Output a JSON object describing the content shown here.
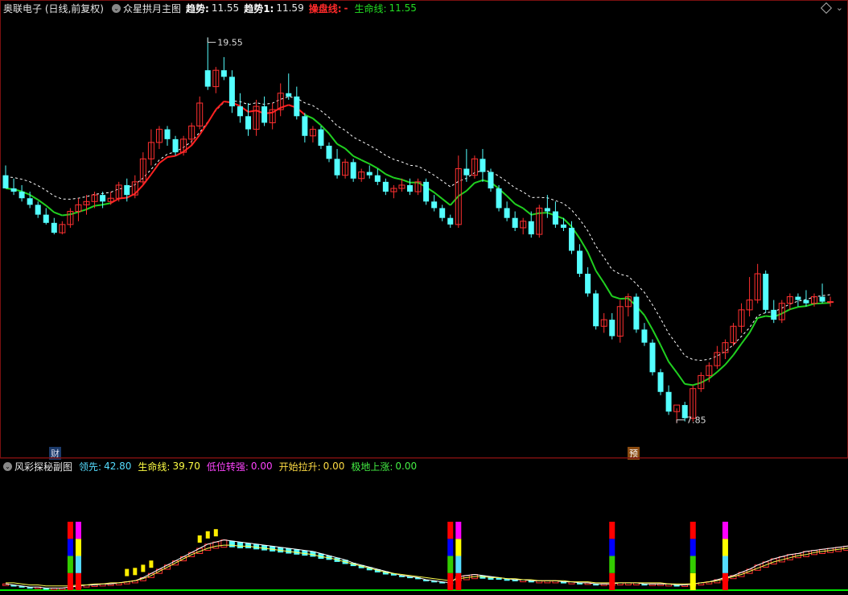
{
  "main_header": {
    "stock": "奥联电子 (日线,前复权)",
    "indicator": "众星拱月主图",
    "trend_label": "趋势:",
    "trend_value": "11.55",
    "trend1_label": "趋势1:",
    "trend1_value": "11.59",
    "operate_label": "操盘线:",
    "operate_value": "-",
    "life_label": "生命线:",
    "life_value": "11.55"
  },
  "sub_header": {
    "indicator": "风彩探秘副图",
    "lead_label": "领先:",
    "lead_value": "42.80",
    "life_label": "生命线:",
    "life_value": "39.70",
    "low_label": "低位转强:",
    "low_value": "0.00",
    "start_label": "开始拉升:",
    "start_value": "0.00",
    "bottom_label": "极地上涨:",
    "bottom_value": "0.00"
  },
  "markers": {
    "cai": "财",
    "yu": "预"
  },
  "colors": {
    "up": "#ff3030",
    "down": "#54ffff",
    "life_up": "#ff2020",
    "life_down": "#20d020",
    "lead_line": "#ffffff",
    "life_line": "#ffff50",
    "base_line": "#00ee00"
  },
  "chart_data": {
    "type": "candlestick",
    "price_range": [
      7.2,
      20.2
    ],
    "max_label": "19.55",
    "min_label": "7.85",
    "candles": [
      [
        15.4,
        15.7,
        15.0,
        15.0
      ],
      [
        15.0,
        15.3,
        14.8,
        14.9
      ],
      [
        14.9,
        15.1,
        14.6,
        14.7
      ],
      [
        14.7,
        14.9,
        14.4,
        14.5
      ],
      [
        14.5,
        14.6,
        14.1,
        14.2
      ],
      [
        14.2,
        14.4,
        13.9,
        13.95
      ],
      [
        13.95,
        14.1,
        13.6,
        13.65
      ],
      [
        13.65,
        14.0,
        13.6,
        13.9
      ],
      [
        13.9,
        14.4,
        13.8,
        14.3
      ],
      [
        14.3,
        14.7,
        14.0,
        14.5
      ],
      [
        14.5,
        14.8,
        14.2,
        14.6
      ],
      [
        14.6,
        14.9,
        14.4,
        14.8
      ],
      [
        14.8,
        14.9,
        14.4,
        14.6
      ],
      [
        14.6,
        14.9,
        14.5,
        14.7
      ],
      [
        14.7,
        15.2,
        14.6,
        15.1
      ],
      [
        15.1,
        15.3,
        14.6,
        14.8
      ],
      [
        14.8,
        15.4,
        14.7,
        15.2
      ],
      [
        15.2,
        16.1,
        15.1,
        15.9
      ],
      [
        15.9,
        16.8,
        15.7,
        16.4
      ],
      [
        16.4,
        16.9,
        16.2,
        16.8
      ],
      [
        16.8,
        16.9,
        16.3,
        16.5
      ],
      [
        16.5,
        16.6,
        16.0,
        16.1
      ],
      [
        16.1,
        16.6,
        16.0,
        16.5
      ],
      [
        16.5,
        17.0,
        16.3,
        16.9
      ],
      [
        16.9,
        17.8,
        16.8,
        17.6
      ],
      [
        18.6,
        19.6,
        18.0,
        18.1
      ],
      [
        18.1,
        18.7,
        17.9,
        18.6
      ],
      [
        18.6,
        19.0,
        18.3,
        18.4
      ],
      [
        18.4,
        18.6,
        17.3,
        17.5
      ],
      [
        17.5,
        17.9,
        17.0,
        17.2
      ],
      [
        17.2,
        17.6,
        16.6,
        16.8
      ],
      [
        16.8,
        17.7,
        16.6,
        17.5
      ],
      [
        17.5,
        17.8,
        16.9,
        17.0
      ],
      [
        17.0,
        17.6,
        16.8,
        17.4
      ],
      [
        17.4,
        18.2,
        17.2,
        17.9
      ],
      [
        17.9,
        18.5,
        17.7,
        17.8
      ],
      [
        17.8,
        18.1,
        17.1,
        17.2
      ],
      [
        17.2,
        17.3,
        16.4,
        16.6
      ],
      [
        16.6,
        16.9,
        16.4,
        16.8
      ],
      [
        16.8,
        16.9,
        16.2,
        16.3
      ],
      [
        16.3,
        16.4,
        15.8,
        15.9
      ],
      [
        15.9,
        16.2,
        15.3,
        15.4
      ],
      [
        15.4,
        15.9,
        15.3,
        15.8
      ],
      [
        15.8,
        15.9,
        15.2,
        15.3
      ],
      [
        15.3,
        15.6,
        15.2,
        15.5
      ],
      [
        15.5,
        15.7,
        15.3,
        15.4
      ],
      [
        15.4,
        15.6,
        15.1,
        15.2
      ],
      [
        15.2,
        15.3,
        14.8,
        14.9
      ],
      [
        14.9,
        15.1,
        14.7,
        15.0
      ],
      [
        15.0,
        15.3,
        14.9,
        15.1
      ],
      [
        15.1,
        15.3,
        14.8,
        14.9
      ],
      [
        14.9,
        15.3,
        14.8,
        15.2
      ],
      [
        15.2,
        15.3,
        14.5,
        14.6
      ],
      [
        14.6,
        14.8,
        14.3,
        14.4
      ],
      [
        14.4,
        14.5,
        14.0,
        14.1
      ],
      [
        14.1,
        14.2,
        13.8,
        13.9
      ],
      [
        13.9,
        16.0,
        13.8,
        15.6
      ],
      [
        15.6,
        16.2,
        15.2,
        15.4
      ],
      [
        15.4,
        16.0,
        15.3,
        15.9
      ],
      [
        15.9,
        16.2,
        15.2,
        15.5
      ],
      [
        15.5,
        15.6,
        14.9,
        15.0
      ],
      [
        15.0,
        15.1,
        14.3,
        14.4
      ],
      [
        14.4,
        14.6,
        14.0,
        14.1
      ],
      [
        14.1,
        14.3,
        13.7,
        13.8
      ],
      [
        13.8,
        14.1,
        13.6,
        14.0
      ],
      [
        14.0,
        14.3,
        13.5,
        13.6
      ],
      [
        13.6,
        14.5,
        13.5,
        14.4
      ],
      [
        14.4,
        14.8,
        14.1,
        14.3
      ],
      [
        14.3,
        14.6,
        13.8,
        13.9
      ],
      [
        13.9,
        14.1,
        13.7,
        13.8
      ],
      [
        13.8,
        14.0,
        13.0,
        13.1
      ],
      [
        13.1,
        13.3,
        12.3,
        12.4
      ],
      [
        12.4,
        12.6,
        11.7,
        11.8
      ],
      [
        11.8,
        11.9,
        10.7,
        10.8
      ],
      [
        10.8,
        11.2,
        10.6,
        11.0
      ],
      [
        11.0,
        11.2,
        10.4,
        10.5
      ],
      [
        10.5,
        11.6,
        10.3,
        11.4
      ],
      [
        11.4,
        11.8,
        11.1,
        11.7
      ],
      [
        11.7,
        11.8,
        10.6,
        10.7
      ],
      [
        10.7,
        10.9,
        10.2,
        10.3
      ],
      [
        10.3,
        10.4,
        9.3,
        9.4
      ],
      [
        9.4,
        9.5,
        8.7,
        8.8
      ],
      [
        8.8,
        9.0,
        8.1,
        8.2
      ],
      [
        8.2,
        8.3,
        7.85,
        8.4
      ],
      [
        8.4,
        8.5,
        7.9,
        8.0
      ],
      [
        8.0,
        9.0,
        7.9,
        8.9
      ],
      [
        8.9,
        9.4,
        8.8,
        9.3
      ],
      [
        9.3,
        9.7,
        9.1,
        9.6
      ],
      [
        9.6,
        10.2,
        9.5,
        10.0
      ],
      [
        10.0,
        10.4,
        9.8,
        10.3
      ],
      [
        10.3,
        10.9,
        10.2,
        10.8
      ],
      [
        10.8,
        11.5,
        10.6,
        11.3
      ],
      [
        11.3,
        12.3,
        11.1,
        11.6
      ],
      [
        11.6,
        12.7,
        11.5,
        12.4
      ],
      [
        12.4,
        12.5,
        11.2,
        11.3
      ],
      [
        11.3,
        11.6,
        10.9,
        11.0
      ],
      [
        11.0,
        11.6,
        10.9,
        11.5
      ],
      [
        11.5,
        11.8,
        11.3,
        11.7
      ],
      [
        11.7,
        11.8,
        11.4,
        11.6
      ],
      [
        11.6,
        11.9,
        11.4,
        11.5
      ],
      [
        11.5,
        11.8,
        11.4,
        11.7
      ],
      [
        11.7,
        12.1,
        11.5,
        11.55
      ],
      [
        11.55,
        11.7,
        11.4,
        11.55
      ]
    ],
    "life_line_up_ranges": [
      [
        14,
        37
      ]
    ],
    "sub": {
      "range": [
        0,
        110
      ],
      "lead": [
        6,
        5,
        4,
        3,
        3,
        2,
        2,
        2,
        3,
        4,
        5,
        5,
        6,
        6,
        7,
        8,
        9,
        12,
        16,
        20,
        24,
        28,
        32,
        36,
        40,
        44,
        46,
        48,
        47,
        46,
        45,
        44,
        43,
        42,
        41,
        40,
        39,
        38,
        37,
        35,
        33,
        31,
        29,
        26,
        24,
        22,
        20,
        18,
        16,
        14,
        13,
        12,
        10,
        9,
        8,
        7,
        13,
        14,
        15,
        14,
        13,
        12,
        11,
        10,
        10,
        9,
        9,
        9,
        9,
        8,
        8,
        7,
        7,
        6,
        6,
        6,
        7,
        7,
        7,
        6,
        6,
        6,
        6,
        5,
        5,
        6,
        7,
        8,
        10,
        12,
        14,
        17,
        20,
        24,
        27,
        30,
        32,
        34,
        35,
        37,
        38,
        39,
        40,
        41,
        42,
        43
      ],
      "life": [
        7,
        7,
        6,
        5,
        5,
        4,
        4,
        4,
        4,
        5,
        5,
        6,
        6,
        7,
        7,
        8,
        9,
        11,
        14,
        18,
        22,
        26,
        30,
        34,
        37,
        40,
        42,
        43,
        43,
        42,
        42,
        41,
        40,
        39,
        38,
        37,
        36,
        35,
        34,
        32,
        31,
        29,
        27,
        25,
        23,
        21,
        19,
        17,
        16,
        15,
        14,
        13,
        12,
        11,
        10,
        9,
        11,
        12,
        13,
        13,
        12,
        12,
        11,
        11,
        10,
        10,
        9,
        9,
        9,
        9,
        8,
        8,
        8,
        7,
        7,
        7,
        7,
        7,
        7,
        7,
        7,
        7,
        6,
        6,
        6,
        6,
        7,
        8,
        9,
        11,
        13,
        15,
        18,
        21,
        24,
        27,
        29,
        31,
        33,
        34,
        36,
        37,
        38,
        39,
        40,
        41
      ],
      "yellow_flags": [
        15,
        16,
        17,
        18,
        24,
        25,
        26
      ],
      "signal_bars": [
        {
          "x": 8,
          "h": 44,
          "colors": [
            "#ff0000",
            "#0000ff",
            "#33cc00",
            "#ff0000"
          ]
        },
        {
          "x": 9,
          "h": 44,
          "colors": [
            "#ff00ff",
            "#ffff00",
            "#55ddff",
            "#ff0000"
          ]
        },
        {
          "x": 55,
          "h": 44,
          "colors": [
            "#ff0000",
            "#0000ff",
            "#33cc00",
            "#ff0000"
          ]
        },
        {
          "x": 56,
          "h": 44,
          "colors": [
            "#ff00ff",
            "#ffff00",
            "#55ddff",
            "#ff0000"
          ]
        },
        {
          "x": 75,
          "h": 44,
          "colors": [
            "#ff0000",
            "#0000ff",
            "#33cc00",
            "#ff0000"
          ]
        },
        {
          "x": 85,
          "h": 44,
          "colors": [
            "#ff0000",
            "#0000ff",
            "#33cc00",
            "#ffff00"
          ]
        },
        {
          "x": 89,
          "h": 44,
          "colors": [
            "#ff00ff",
            "#ffff00",
            "#55ddff",
            "#ff0000"
          ]
        }
      ]
    }
  }
}
